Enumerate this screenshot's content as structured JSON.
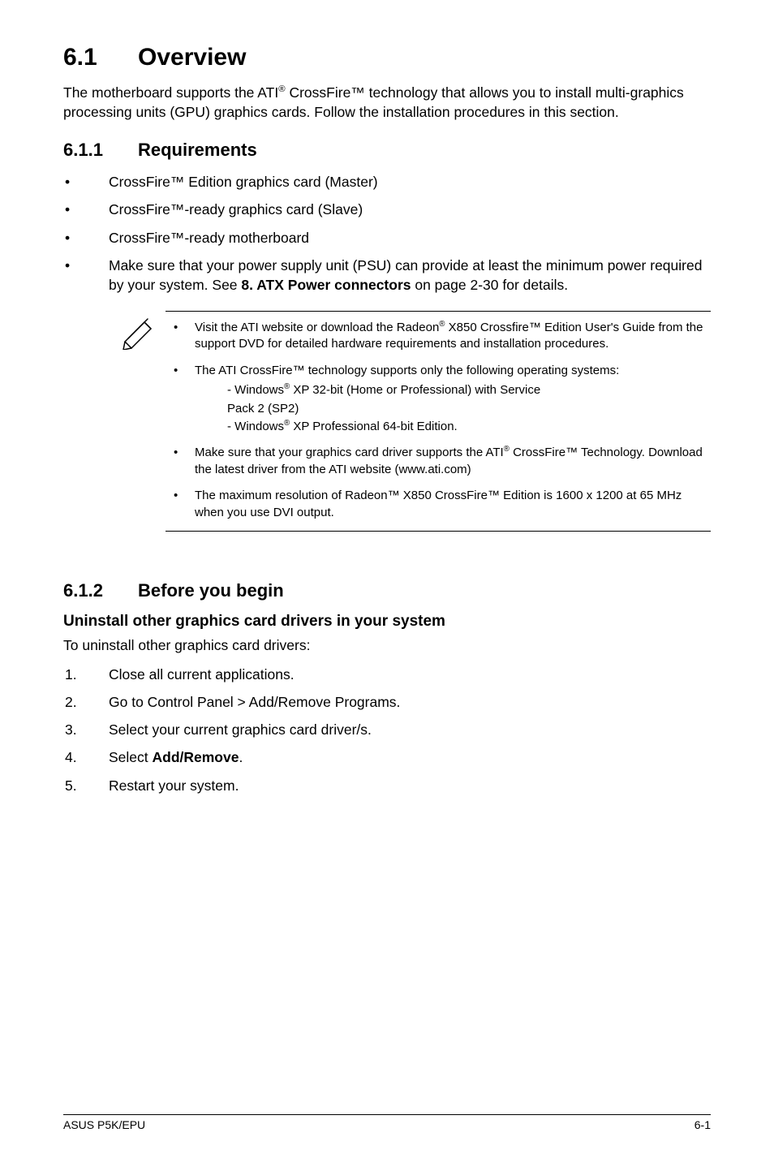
{
  "heading1": {
    "num": "6.1",
    "title": "Overview"
  },
  "intro": "The motherboard supports the ATI® CrossFire™ technology that allows you to install multi-graphics processing units (GPU) graphics cards. Follow the installation procedures in this section.",
  "sec611": {
    "num": "6.1.1",
    "title": "Requirements"
  },
  "reqs": [
    "CrossFire™ Edition graphics card (Master)",
    "CrossFire™-ready graphics card (Slave)",
    "CrossFire™-ready motherboard",
    "Make sure that your power supply unit (PSU) can provide at least the minimum power required by your system. See 8. ATX Power connectors on page 2-30 for details."
  ],
  "req4_prefix": "Make sure that your power supply unit (PSU) can provide at least the minimum power required by your system. See ",
  "req4_bold": "8. ATX Power connectors",
  "req4_suffix": " on page 2-30 for details.",
  "notes": {
    "n1_a": "Visit the ATI website or download the Radeon",
    "n1_b": " X850 Crossfire™ Edition User's Guide from the support DVD for detailed hardware requirements and installation procedures.",
    "n2_intro": "The ATI CrossFire™ technology supports only the following operating systems:",
    "n2_sub1_a": "- Windows",
    "n2_sub1_b": " XP 32-bit  (Home or Professional) with Service",
    "n2_sub1_c": "  Pack 2 (SP2)",
    "n2_sub2_a": "- Windows",
    "n2_sub2_b": " XP Professional 64-bit Edition.",
    "n3_a": "Make sure that your graphics card driver supports the ATI",
    "n3_b": " CrossFire™ Technology. Download the latest driver from the ATI website (www.ati.com)",
    "n4": "The maximum resolution of Radeon™ X850 CrossFire™ Edition is 1600 x 1200 at 65 MHz when you use DVI output."
  },
  "sec612": {
    "num": "6.1.2",
    "title": "Before you begin"
  },
  "uninstall_heading": "Uninstall other graphics card drivers in your system",
  "uninstall_intro": "To uninstall other graphics card drivers:",
  "steps": [
    "Close all current applications.",
    "Go to Control Panel > Add/Remove Programs.",
    "Select your current graphics card driver/s."
  ],
  "step4_prefix": "Select ",
  "step4_bold": "Add/Remove",
  "step4_suffix": ".",
  "step5": "Restart your system.",
  "footer_left": "ASUS P5K/EPU",
  "footer_right": "6-1"
}
